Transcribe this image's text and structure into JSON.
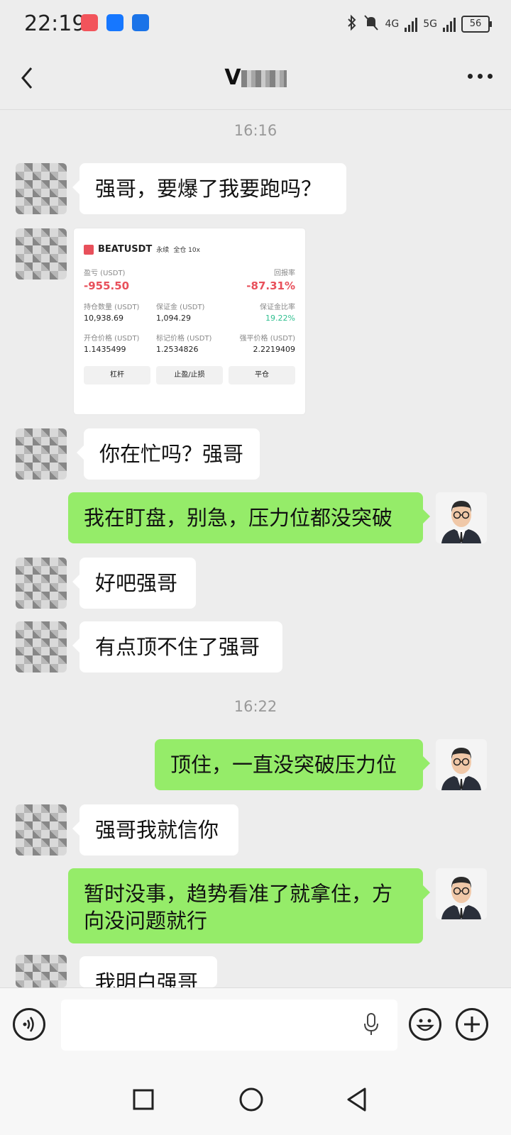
{
  "status": {
    "time": "22:19",
    "network1": "4G",
    "network2": "5G",
    "battery": "56"
  },
  "header": {
    "contact_name": "V"
  },
  "messages": {
    "ts1": "16:16",
    "m1": "强哥，要爆了我要跑吗？",
    "m3": "你在忙吗？强哥",
    "m4": "我在盯盘，别急，压力位都没突破",
    "m5": "好吧强哥",
    "m6": "有点顶不住了强哥",
    "ts2": "16:22",
    "m7": "顶住，一直没突破压力位",
    "m8": "强哥我就信你",
    "m9": "暂时没事，趋势看准了就拿住，方向没问题就行",
    "m10": "我明白强哥"
  },
  "card": {
    "symbol": "BEATUSDT",
    "tag1": "永续",
    "tag2": "全仓 10x",
    "pnl_label": "盈亏 (USDT)",
    "pnl_value": "-955.50",
    "roe_label": "回报率",
    "roe_value": "-87.31%",
    "size_label": "持仓数量 (USDT)",
    "size_value": "10,938.69",
    "margin_label": "保证金 (USDT)",
    "margin_value": "1,094.29",
    "margin_ratio_label": "保证金比率",
    "margin_ratio_value": "19.22%",
    "entry_label": "开仓价格 (USDT)",
    "entry_value": "1.1435499",
    "mark_label": "标记价格 (USDT)",
    "mark_value": "1.2534826",
    "liq_label": "强平价格 (USDT)",
    "liq_value": "2.2219409",
    "btn_leverage": "杠杆",
    "btn_tpsl": "止盈/止损",
    "btn_close": "平仓"
  },
  "icons": {
    "voice": "voice-icon",
    "mic": "mic-icon",
    "emoji": "emoji-icon",
    "plus": "plus-icon"
  },
  "colors": {
    "outgoing_bubble": "#95ec69",
    "incoming_bubble": "#ffffff",
    "background": "#ededed",
    "loss_red": "#e8505b",
    "ratio_green": "#2fbf8f"
  }
}
